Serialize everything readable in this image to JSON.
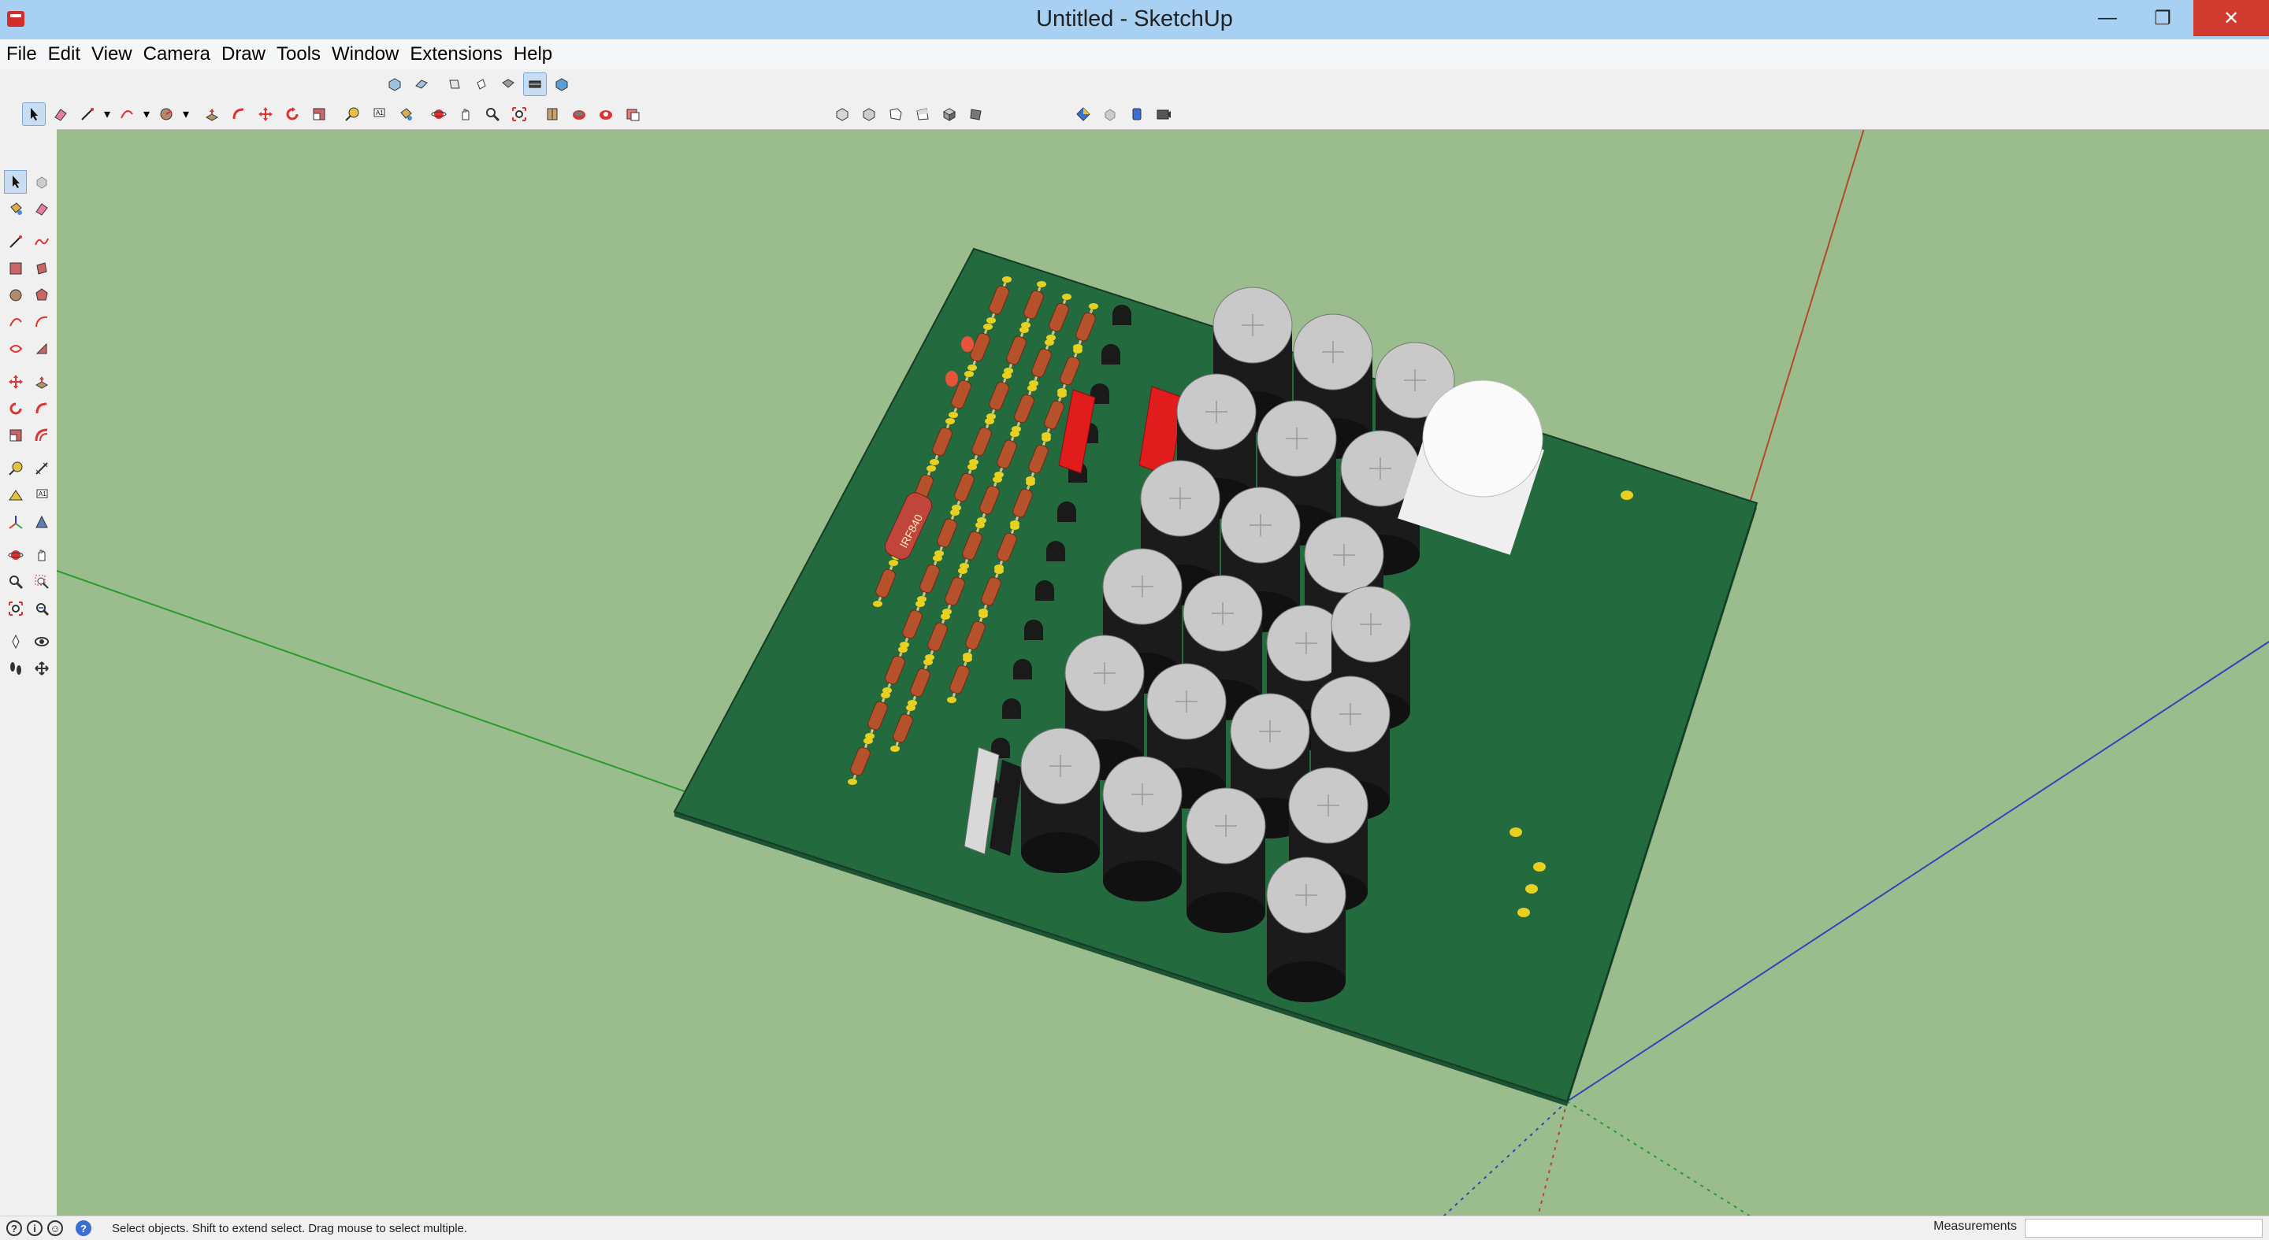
{
  "window": {
    "title": "Untitled - SketchUp",
    "minimize_label": "—",
    "restore_label": "❐",
    "close_label": "✕"
  },
  "menu": [
    "File",
    "Edit",
    "View",
    "Camera",
    "Draw",
    "Tools",
    "Window",
    "Extensions",
    "Help"
  ],
  "toolbar_top": [
    "iso-view-icon",
    "top-view-icon",
    "front-view-icon",
    "right-view-icon",
    "back-view-icon",
    "left-view-icon",
    "bottom-view-icon"
  ],
  "toolbar_main": [
    "select-icon",
    "eraser-icon",
    "line-icon",
    "arc-icon",
    "circle-icon",
    "push-pull-icon",
    "follow-me-icon",
    "move-icon",
    "rotate-icon",
    "scale-icon",
    "tape-measure-icon",
    "text-icon",
    "paint-bucket-icon",
    "orbit-icon",
    "pan-icon",
    "zoom-icon",
    "zoom-extents-icon",
    "section-plane-icon",
    "3d-warehouse-icon",
    "extension-warehouse-icon",
    "layout-icon"
  ],
  "toolbar_styles": [
    "xray-icon",
    "back-edges-icon",
    "wireframe-icon",
    "hidden-line-icon",
    "shaded-icon",
    "shaded-textures-icon"
  ],
  "toolbar_extras": [
    "sandbox-icon",
    "component-icon",
    "layer-icon",
    "camera-icon"
  ],
  "colors": {
    "titlebar": "#a7d0f2",
    "ground": "#9bbd8d",
    "pcb": "#246a3f",
    "pcb_edge": "#1d5233",
    "capacitor_body": "#1b1b1b",
    "capacitor_top": "#c9c9c9",
    "resistor": "#b5522c",
    "relay": "#e01c1c",
    "axis_red": "#b7462f",
    "axis_green": "#2a9a2a",
    "axis_blue": "#3045b7"
  },
  "status": {
    "hint": "Select objects. Shift to extend select. Drag mouse to select multiple.",
    "measurements_label": "Measurements"
  },
  "pcb_label": "IRF840"
}
